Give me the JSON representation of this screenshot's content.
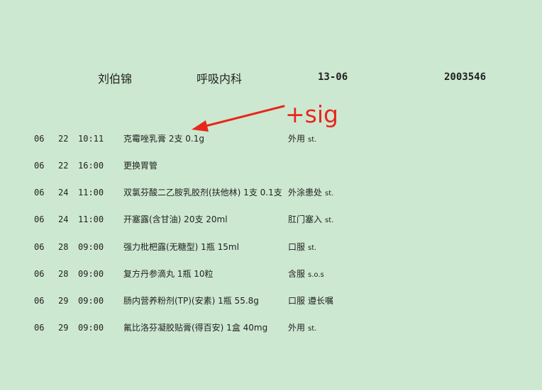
{
  "header": {
    "patient_name": "刘伯锦",
    "department": "呼吸内科",
    "bed": "13-06",
    "record_no": "2003546"
  },
  "annotation": {
    "text": "+sig",
    "color": "#e8261c"
  },
  "orders": [
    {
      "month": "06",
      "day": "22",
      "time": "10:11",
      "drug": "克霉唑乳膏 2支 0.1g",
      "route": "外用",
      "freq": "st."
    },
    {
      "month": "06",
      "day": "22",
      "time": "16:00",
      "drug": "更换胃管",
      "route": "",
      "freq": ""
    },
    {
      "month": "06",
      "day": "24",
      "time": "11:00",
      "drug": "双氯芬酸二乙胺乳胶剂(扶他林) 1支 0.1支",
      "route": "外涂患处",
      "freq": "st."
    },
    {
      "month": "06",
      "day": "24",
      "time": "11:00",
      "drug": "开塞露(含甘油) 20支 20ml",
      "route": "肛门塞入",
      "freq": "st."
    },
    {
      "month": "06",
      "day": "28",
      "time": "09:00",
      "drug": "强力枇杷露(无糖型)  1瓶 15ml",
      "route": "口服",
      "freq": "st."
    },
    {
      "month": "06",
      "day": "28",
      "time": "09:00",
      "drug": "复方丹参滴丸 1瓶 10粒",
      "route": "含服",
      "freq": "s.o.s"
    },
    {
      "month": "06",
      "day": "29",
      "time": "09:00",
      "drug": "肠内营养粉剂(TP)(安素) 1瓶 55.8g",
      "route": "口服",
      "freq": "遵长嘱"
    },
    {
      "month": "06",
      "day": "29",
      "time": "09:00",
      "drug": "氟比洛芬凝胶贴膏(得百安) 1盒 40mg",
      "route": "外用",
      "freq": "st."
    }
  ]
}
